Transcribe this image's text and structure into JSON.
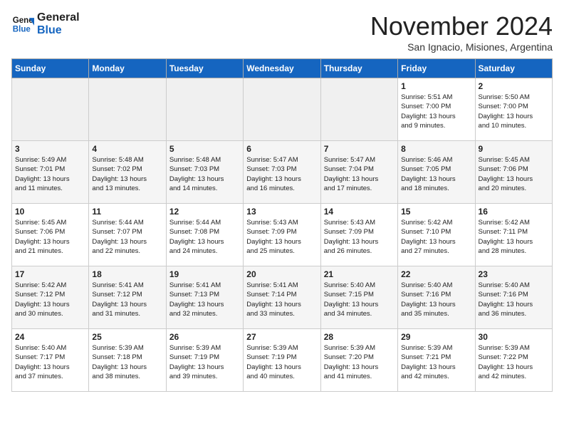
{
  "logo": {
    "line1": "General",
    "line2": "Blue"
  },
  "title": "November 2024",
  "location": "San Ignacio, Misiones, Argentina",
  "weekdays": [
    "Sunday",
    "Monday",
    "Tuesday",
    "Wednesday",
    "Thursday",
    "Friday",
    "Saturday"
  ],
  "weeks": [
    [
      {
        "day": "",
        "info": ""
      },
      {
        "day": "",
        "info": ""
      },
      {
        "day": "",
        "info": ""
      },
      {
        "day": "",
        "info": ""
      },
      {
        "day": "",
        "info": ""
      },
      {
        "day": "1",
        "info": "Sunrise: 5:51 AM\nSunset: 7:00 PM\nDaylight: 13 hours\nand 9 minutes."
      },
      {
        "day": "2",
        "info": "Sunrise: 5:50 AM\nSunset: 7:00 PM\nDaylight: 13 hours\nand 10 minutes."
      }
    ],
    [
      {
        "day": "3",
        "info": "Sunrise: 5:49 AM\nSunset: 7:01 PM\nDaylight: 13 hours\nand 11 minutes."
      },
      {
        "day": "4",
        "info": "Sunrise: 5:48 AM\nSunset: 7:02 PM\nDaylight: 13 hours\nand 13 minutes."
      },
      {
        "day": "5",
        "info": "Sunrise: 5:48 AM\nSunset: 7:03 PM\nDaylight: 13 hours\nand 14 minutes."
      },
      {
        "day": "6",
        "info": "Sunrise: 5:47 AM\nSunset: 7:03 PM\nDaylight: 13 hours\nand 16 minutes."
      },
      {
        "day": "7",
        "info": "Sunrise: 5:47 AM\nSunset: 7:04 PM\nDaylight: 13 hours\nand 17 minutes."
      },
      {
        "day": "8",
        "info": "Sunrise: 5:46 AM\nSunset: 7:05 PM\nDaylight: 13 hours\nand 18 minutes."
      },
      {
        "day": "9",
        "info": "Sunrise: 5:45 AM\nSunset: 7:06 PM\nDaylight: 13 hours\nand 20 minutes."
      }
    ],
    [
      {
        "day": "10",
        "info": "Sunrise: 5:45 AM\nSunset: 7:06 PM\nDaylight: 13 hours\nand 21 minutes."
      },
      {
        "day": "11",
        "info": "Sunrise: 5:44 AM\nSunset: 7:07 PM\nDaylight: 13 hours\nand 22 minutes."
      },
      {
        "day": "12",
        "info": "Sunrise: 5:44 AM\nSunset: 7:08 PM\nDaylight: 13 hours\nand 24 minutes."
      },
      {
        "day": "13",
        "info": "Sunrise: 5:43 AM\nSunset: 7:09 PM\nDaylight: 13 hours\nand 25 minutes."
      },
      {
        "day": "14",
        "info": "Sunrise: 5:43 AM\nSunset: 7:09 PM\nDaylight: 13 hours\nand 26 minutes."
      },
      {
        "day": "15",
        "info": "Sunrise: 5:42 AM\nSunset: 7:10 PM\nDaylight: 13 hours\nand 27 minutes."
      },
      {
        "day": "16",
        "info": "Sunrise: 5:42 AM\nSunset: 7:11 PM\nDaylight: 13 hours\nand 28 minutes."
      }
    ],
    [
      {
        "day": "17",
        "info": "Sunrise: 5:42 AM\nSunset: 7:12 PM\nDaylight: 13 hours\nand 30 minutes."
      },
      {
        "day": "18",
        "info": "Sunrise: 5:41 AM\nSunset: 7:12 PM\nDaylight: 13 hours\nand 31 minutes."
      },
      {
        "day": "19",
        "info": "Sunrise: 5:41 AM\nSunset: 7:13 PM\nDaylight: 13 hours\nand 32 minutes."
      },
      {
        "day": "20",
        "info": "Sunrise: 5:41 AM\nSunset: 7:14 PM\nDaylight: 13 hours\nand 33 minutes."
      },
      {
        "day": "21",
        "info": "Sunrise: 5:40 AM\nSunset: 7:15 PM\nDaylight: 13 hours\nand 34 minutes."
      },
      {
        "day": "22",
        "info": "Sunrise: 5:40 AM\nSunset: 7:16 PM\nDaylight: 13 hours\nand 35 minutes."
      },
      {
        "day": "23",
        "info": "Sunrise: 5:40 AM\nSunset: 7:16 PM\nDaylight: 13 hours\nand 36 minutes."
      }
    ],
    [
      {
        "day": "24",
        "info": "Sunrise: 5:40 AM\nSunset: 7:17 PM\nDaylight: 13 hours\nand 37 minutes."
      },
      {
        "day": "25",
        "info": "Sunrise: 5:39 AM\nSunset: 7:18 PM\nDaylight: 13 hours\nand 38 minutes."
      },
      {
        "day": "26",
        "info": "Sunrise: 5:39 AM\nSunset: 7:19 PM\nDaylight: 13 hours\nand 39 minutes."
      },
      {
        "day": "27",
        "info": "Sunrise: 5:39 AM\nSunset: 7:19 PM\nDaylight: 13 hours\nand 40 minutes."
      },
      {
        "day": "28",
        "info": "Sunrise: 5:39 AM\nSunset: 7:20 PM\nDaylight: 13 hours\nand 41 minutes."
      },
      {
        "day": "29",
        "info": "Sunrise: 5:39 AM\nSunset: 7:21 PM\nDaylight: 13 hours\nand 42 minutes."
      },
      {
        "day": "30",
        "info": "Sunrise: 5:39 AM\nSunset: 7:22 PM\nDaylight: 13 hours\nand 42 minutes."
      }
    ]
  ]
}
